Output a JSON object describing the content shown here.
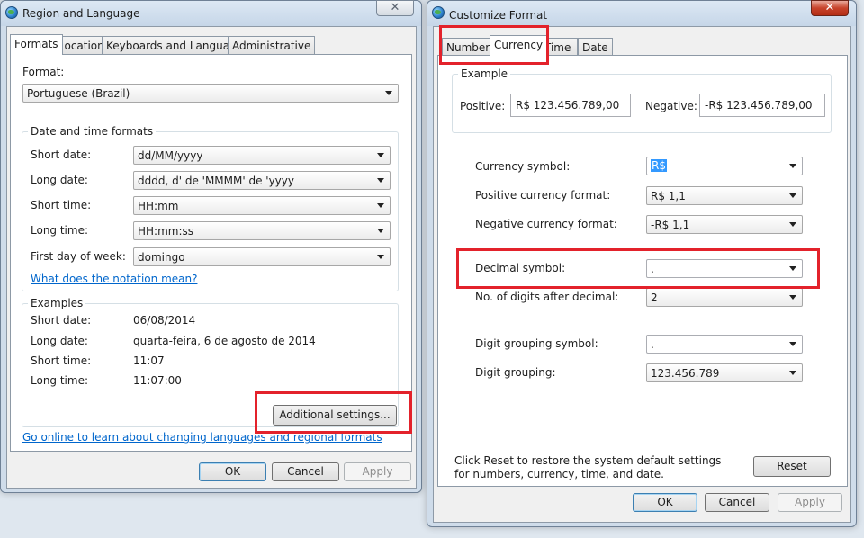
{
  "region_window": {
    "title": "Region and Language",
    "tabs": [
      "Formats",
      "Location",
      "Keyboards and Languages",
      "Administrative"
    ],
    "format_label": "Format:",
    "format_value": "Portuguese (Brazil)",
    "date_time_group": "Date and time formats",
    "fields": [
      {
        "label": "Short date:",
        "value": "dd/MM/yyyy"
      },
      {
        "label": "Long date:",
        "value": "dddd, d' de 'MMMM' de 'yyyy"
      },
      {
        "label": "Short time:",
        "value": "HH:mm"
      },
      {
        "label": "Long time:",
        "value": "HH:mm:ss"
      },
      {
        "label": "First day of week:",
        "value": "domingo"
      }
    ],
    "notation_link": "What does the notation mean?",
    "examples_group": "Examples",
    "examples": [
      {
        "label": "Short date:",
        "value": "06/08/2014"
      },
      {
        "label": "Long date:",
        "value": "quarta-feira, 6 de agosto de 2014"
      },
      {
        "label": "Short time:",
        "value": "11:07"
      },
      {
        "label": "Long time:",
        "value": "11:07:00"
      }
    ],
    "additional_settings": "Additional settings...",
    "online_link": "Go online to learn about changing languages and regional formats",
    "buttons": {
      "ok": "OK",
      "cancel": "Cancel",
      "apply": "Apply"
    }
  },
  "customize_window": {
    "title": "Customize Format",
    "tabs": [
      "Numbers",
      "Currency",
      "Time",
      "Date"
    ],
    "example_group": "Example",
    "positive_label": "Positive:",
    "positive_value": "R$ 123.456.789,00",
    "negative_label": "Negative:",
    "negative_value": "-R$ 123.456.789,00",
    "settings": [
      {
        "label": "Currency symbol:",
        "value": "R$"
      },
      {
        "label": "Positive currency format:",
        "value": "R$ 1,1"
      },
      {
        "label": "Negative currency format:",
        "value": "-R$ 1,1"
      },
      {
        "label": "Decimal symbol:",
        "value": ","
      },
      {
        "label": "No. of digits after decimal:",
        "value": "2"
      },
      {
        "label": "Digit grouping symbol:",
        "value": "."
      },
      {
        "label": "Digit grouping:",
        "value": "123.456.789"
      }
    ],
    "reset_text": "Click Reset to restore the system default settings for numbers, currency, time, and date.",
    "reset_button": "Reset",
    "buttons": {
      "ok": "OK",
      "cancel": "Cancel",
      "apply": "Apply"
    }
  },
  "colors": {
    "highlight": "#e3222b",
    "link": "#0066cc",
    "selection": "#3399ff"
  },
  "icons": {
    "window": "globe-icon",
    "close": "close-icon",
    "dropdown": "chevron-down-icon"
  }
}
